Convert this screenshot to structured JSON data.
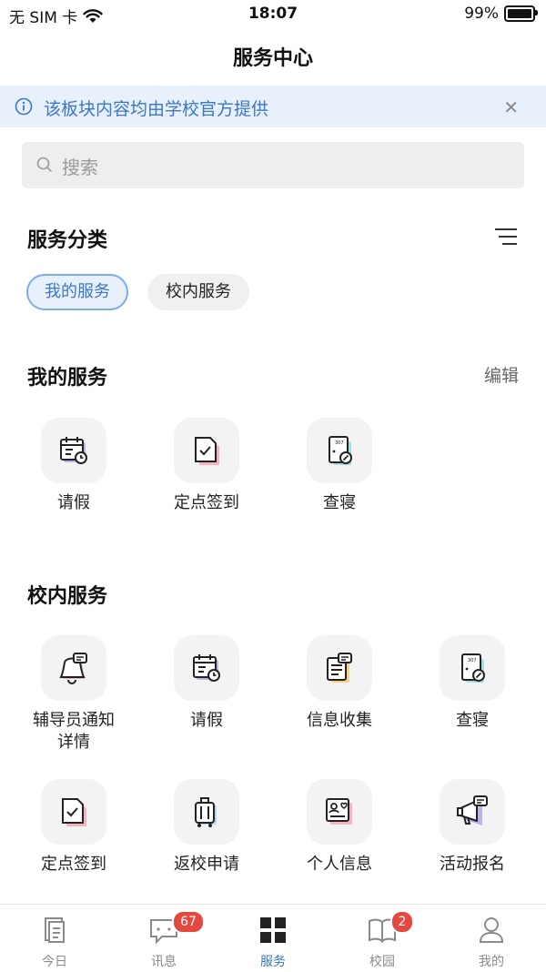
{
  "status": {
    "carrier": "无 SIM 卡",
    "time": "18:07",
    "battery": "99%",
    "battery_level": 0.99
  },
  "header": {
    "title": "服务中心"
  },
  "notice": {
    "text": "该板块内容均由学校官方提供"
  },
  "search": {
    "placeholder": "搜索"
  },
  "categories": {
    "title": "服务分类",
    "chips": [
      "我的服务",
      "校内服务"
    ],
    "active": "我的服务"
  },
  "my_services": {
    "title": "我的服务",
    "edit_label": "编辑",
    "items": [
      {
        "label": "请假",
        "icon": "leave-icon"
      },
      {
        "label": "定点签到",
        "icon": "check-in-icon"
      },
      {
        "label": "查寝",
        "icon": "dorm-check-icon"
      }
    ]
  },
  "campus_services": {
    "title": "校内服务",
    "items": [
      {
        "label": "辅导员通知\n详情",
        "icon": "counselor-notice-icon"
      },
      {
        "label": "请假",
        "icon": "leave-icon"
      },
      {
        "label": "信息收集",
        "icon": "info-collect-icon"
      },
      {
        "label": "查寝",
        "icon": "dorm-check-icon"
      },
      {
        "label": "定点签到",
        "icon": "check-in-icon"
      },
      {
        "label": "返校申请",
        "icon": "return-school-icon"
      },
      {
        "label": "个人信息",
        "icon": "personal-info-icon"
      },
      {
        "label": "活动报名",
        "icon": "activity-signup-icon"
      }
    ]
  },
  "tabbar": {
    "items": [
      {
        "label": "今日",
        "icon": "today-icon"
      },
      {
        "label": "讯息",
        "icon": "message-icon",
        "badge": "67"
      },
      {
        "label": "服务",
        "icon": "service-grid-icon",
        "active": true
      },
      {
        "label": "校园",
        "icon": "campus-book-icon",
        "badge": "2"
      },
      {
        "label": "我的",
        "icon": "profile-icon"
      }
    ]
  },
  "colors": {
    "accent": "#3b78c4",
    "notice_bg": "#e7f0fb",
    "badge": "#e5483f",
    "tile_bg": "#f3f3f3"
  }
}
